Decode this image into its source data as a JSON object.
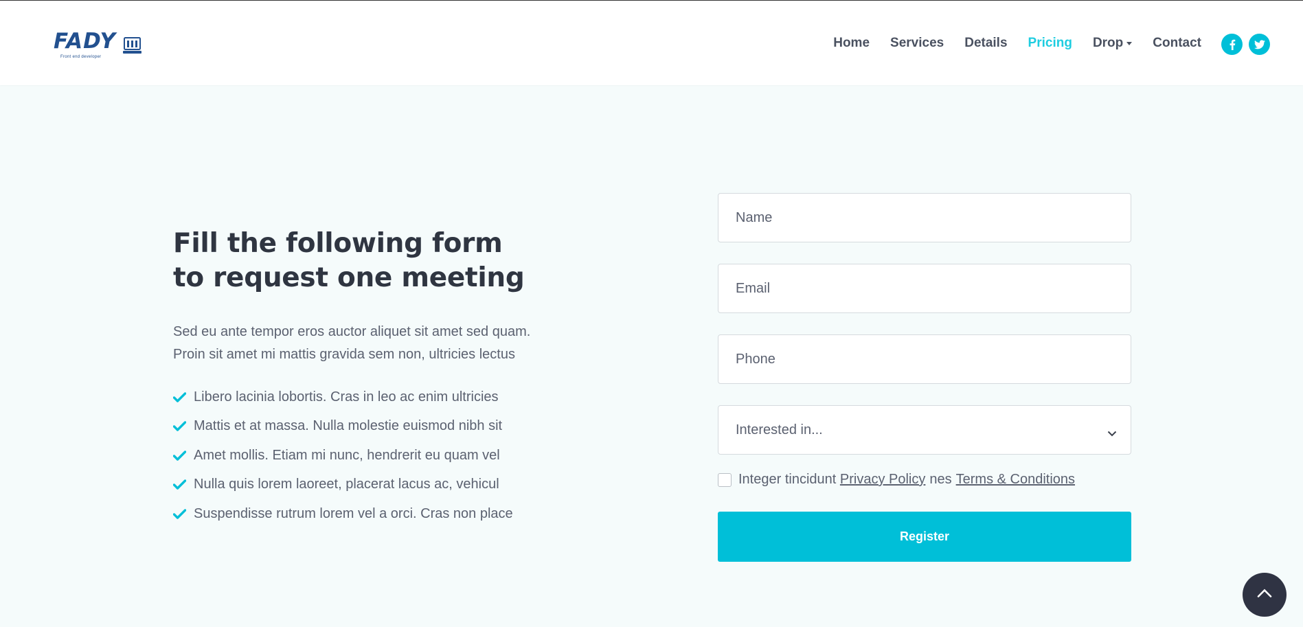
{
  "brand": {
    "name": "FADY",
    "tagline": "Front end developer"
  },
  "nav": {
    "items": [
      {
        "label": "Home"
      },
      {
        "label": "Services"
      },
      {
        "label": "Details"
      },
      {
        "label": "Pricing",
        "active": true
      },
      {
        "label": "Drop",
        "dropdown": true
      },
      {
        "label": "Contact"
      }
    ]
  },
  "social": [
    {
      "icon": "facebook-icon",
      "glyph": "f"
    },
    {
      "icon": "twitter-icon"
    }
  ],
  "hero": {
    "title_line1": "Fill the following form",
    "title_line2": "to request one meeting",
    "intro_line1": "Sed eu ante tempor eros auctor aliquet sit amet sed quam.",
    "intro_line2": "Proin sit amet mi mattis gravida sem non, ultricies lectus",
    "bullets": [
      "Libero lacinia lobortis. Cras in leo ac enim ultricies",
      "Mattis et at massa. Nulla molestie euismod nibh sit",
      "Amet mollis. Etiam mi nunc, hendrerit eu quam vel",
      "Nulla quis lorem laoreet, placerat lacus ac, vehicul",
      "Suspendisse rutrum lorem vel a orci. Cras non place"
    ]
  },
  "form": {
    "name_placeholder": "Name",
    "email_placeholder": "Email",
    "phone_placeholder": "Phone",
    "interest_selected": "Interested in...",
    "agree_prefix": "Integer tincidunt",
    "privacy_label": "Privacy Policy",
    "agree_mid": "nes",
    "terms_label": "Terms & Conditions",
    "submit_label": "Register"
  },
  "colors": {
    "accent": "#00bfd8",
    "active_nav": "#1fcde0",
    "heading": "#2f3541",
    "scroll_button": "#2f3343"
  }
}
